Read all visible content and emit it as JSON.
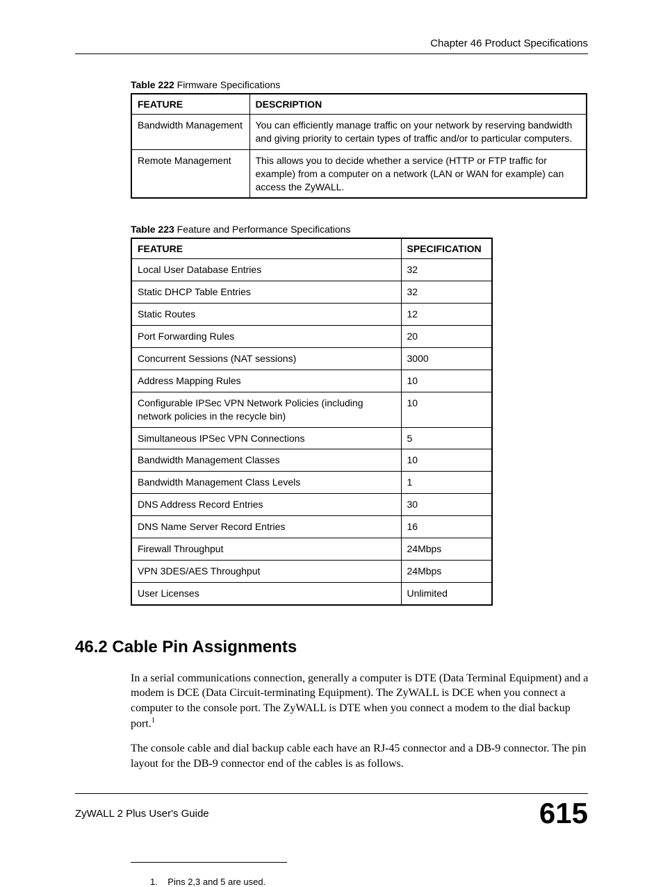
{
  "header": {
    "chapter": "Chapter 46 Product Specifications"
  },
  "table222": {
    "caption_bold": "Table 222",
    "caption_rest": "   Firmware Specifications",
    "headers": {
      "feature": "FEATURE",
      "description": "DESCRIPTION"
    },
    "rows": [
      {
        "feature": "Bandwidth Management",
        "description": "You can efficiently manage traffic on your network by reserving bandwidth and giving priority to certain types of traffic and/or to particular computers."
      },
      {
        "feature": "Remote Management",
        "description": "This allows you to decide whether a service (HTTP or FTP traffic for example) from a computer on a network (LAN or WAN for example) can access the ZyWALL."
      }
    ]
  },
  "table223": {
    "caption_bold": "Table 223",
    "caption_rest": "   Feature and Performance Specifications",
    "headers": {
      "feature": "FEATURE",
      "spec": "SPECIFICATION"
    },
    "rows": [
      {
        "feature": "Local User Database Entries",
        "spec": "32"
      },
      {
        "feature": "Static DHCP Table Entries",
        "spec": "32"
      },
      {
        "feature": "Static Routes",
        "spec": "12"
      },
      {
        "feature": "Port Forwarding Rules",
        "spec": "20"
      },
      {
        "feature": "Concurrent Sessions (NAT sessions)",
        "spec": "3000"
      },
      {
        "feature": "Address Mapping Rules",
        "spec": "10"
      },
      {
        "feature": "Configurable IPSec VPN Network Policies (including network policies in the recycle bin)",
        "spec": "10"
      },
      {
        "feature": "Simultaneous IPSec VPN Connections",
        "spec": "5"
      },
      {
        "feature": "Bandwidth Management Classes",
        "spec": "10"
      },
      {
        "feature": "Bandwidth Management Class Levels",
        "spec": "1"
      },
      {
        "feature": "DNS Address Record Entries",
        "spec": "30"
      },
      {
        "feature": "DNS Name Server Record Entries",
        "spec": "16"
      },
      {
        "feature": "Firewall Throughput",
        "spec": "24Mbps"
      },
      {
        "feature": "VPN 3DES/AES Throughput",
        "spec": "24Mbps"
      },
      {
        "feature": "User Licenses",
        "spec": "Unlimited"
      }
    ]
  },
  "section": {
    "heading": "46.2  Cable Pin Assignments",
    "para1_a": "In a serial communications connection, generally a computer is DTE (Data Terminal Equipment) and a modem is DCE (Data Circuit-terminating Equipment). The ZyWALL is DCE when you connect a computer to the console port. The ZyWALL is DTE when you connect a modem to the dial backup port.",
    "para1_sup": "1",
    "para2": "The console cable and dial backup cable each have an RJ-45 connector and a DB-9 connector. The pin layout for the DB-9 connector end of the cables is as follows."
  },
  "footnote": {
    "num": "1.",
    "text": "Pins 2,3 and 5 are used."
  },
  "footer": {
    "left": "ZyWALL 2 Plus User's Guide",
    "right": "615"
  }
}
